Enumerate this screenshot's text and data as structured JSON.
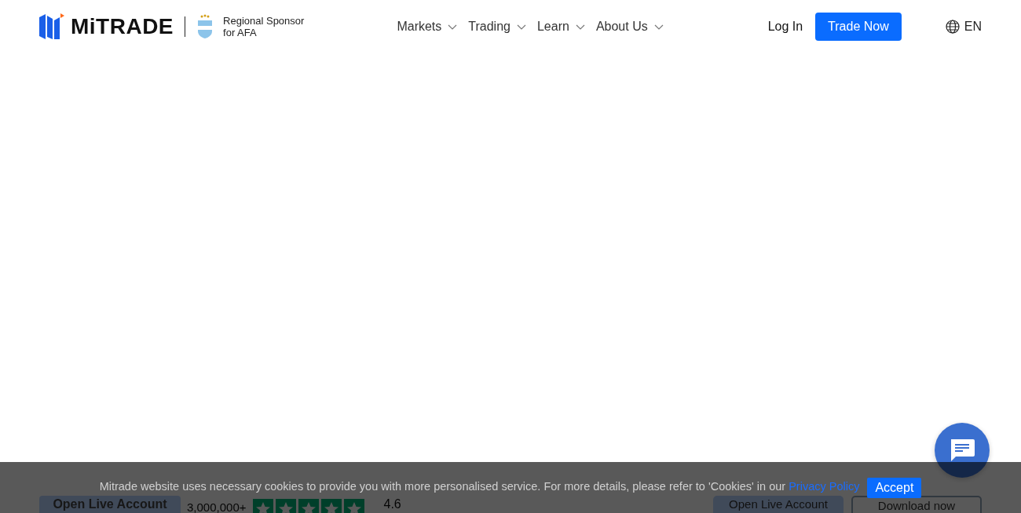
{
  "header": {
    "logo_text": "MiTRADE",
    "sponsor_lines": [
      "Regional Sponsor",
      "for AFA"
    ],
    "nav": [
      {
        "label": "Markets"
      },
      {
        "label": "Trading"
      },
      {
        "label": "Learn"
      },
      {
        "label": "About Us"
      }
    ],
    "login": "Log In",
    "cta": "Trade Now",
    "language": "EN"
  },
  "hero_bottom": {
    "left_button": "Open Live Account",
    "users": "3,000,000+",
    "stars": 5,
    "rating": "4.6",
    "buttons": [
      {
        "label": "Open Live Account",
        "kind": "filled"
      },
      {
        "label": "Download now",
        "kind": "outline"
      }
    ]
  },
  "cookie_bar": {
    "text": "Mitrade website uses necessary cookies to provide you with more personalised service. For more details, please refer to 'Cookies' in our",
    "link": "Privacy Policy",
    "accept": "Accept"
  }
}
